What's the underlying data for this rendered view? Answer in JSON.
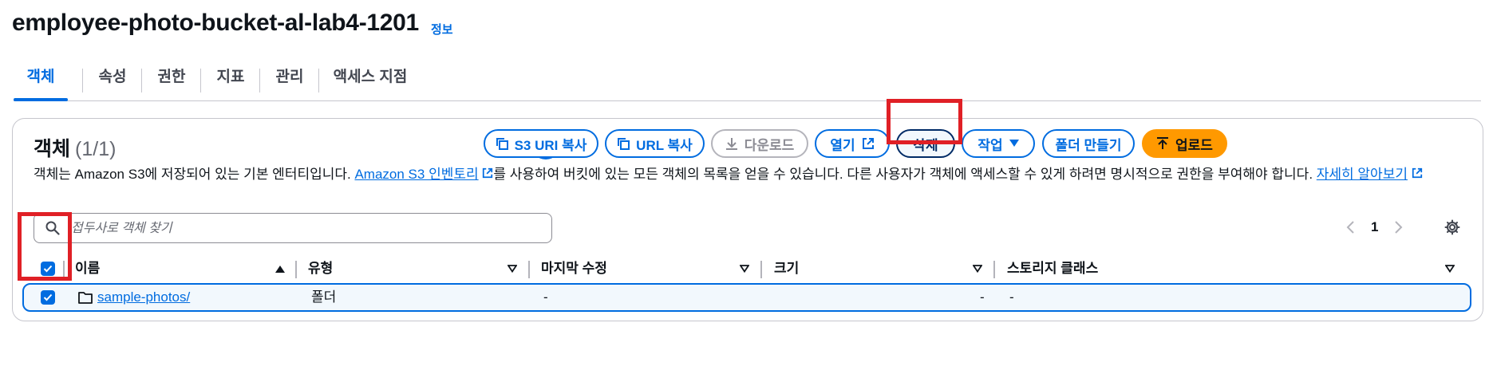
{
  "header": {
    "title": "employee-photo-bucket-al-lab4-1201",
    "info": "정보"
  },
  "tabs": [
    {
      "label": "객체",
      "active": true
    },
    {
      "label": "속성"
    },
    {
      "label": "권한"
    },
    {
      "label": "지표"
    },
    {
      "label": "관리"
    },
    {
      "label": "액세스 지점"
    }
  ],
  "objects": {
    "title": "객체",
    "count": "(1/1)",
    "description_before": "객체는 Amazon S3에 저장되어 있는 기본 엔터티입니다. ",
    "inventory_link": "Amazon S3 인벤토리",
    "description_after": "를 사용하여 버킷에 있는 모든 객체의 목록을 얻을 수 있습니다. 다른 사용자가 객체에 액세스할 수 있게 하려면 명시적으로 권한을 부여해야 합니다. ",
    "learn_more": "자세히 알아보기"
  },
  "toolbar": {
    "copy_s3_uri": "S3 URI 복사",
    "copy_url": "URL 복사",
    "download": "다운로드",
    "open": "열기",
    "delete": "삭제",
    "actions": "작업",
    "create_folder": "폴더 만들기",
    "upload": "업로드"
  },
  "search": {
    "placeholder": "접두사로 객체 찾기"
  },
  "pagination": {
    "page": "1"
  },
  "table": {
    "columns": [
      "이름",
      "유형",
      "마지막 수정",
      "크기",
      "스토리지 클래스"
    ],
    "rows": [
      {
        "name": "sample-photos/",
        "type": "폴더",
        "last_modified": "-",
        "size": "-",
        "storage_class": "-",
        "selected": true
      }
    ]
  },
  "colors": {
    "accent": "#006ce0",
    "primary": "#ff9900",
    "highlight": "#e02026"
  }
}
